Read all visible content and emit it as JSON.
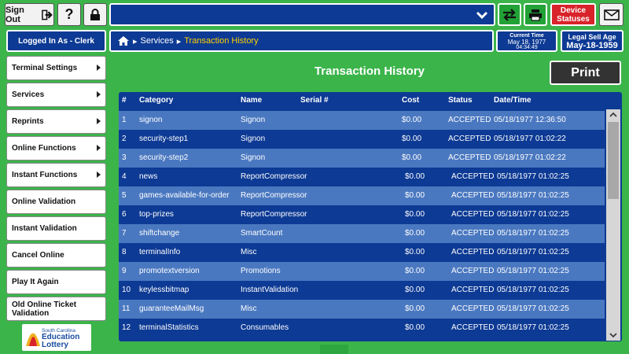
{
  "topbar": {
    "signout_label": "Sign Out",
    "help_label": "?",
    "device_line1": "Device",
    "device_line2": "Statuses"
  },
  "session": {
    "logged_in": "Logged In As - Clerk"
  },
  "breadcrumb": {
    "level1": "Services",
    "level2": "Transaction History"
  },
  "clock": {
    "label": "Current Time",
    "date": "May 18, 1977",
    "time": "04:34:49"
  },
  "sell_age": {
    "label": "Legal Sell Age",
    "date": "May-18-1959"
  },
  "sidebar": {
    "items": [
      {
        "label": "Terminal Settings",
        "arrow": true
      },
      {
        "label": "Services",
        "arrow": true
      },
      {
        "label": "Reprints",
        "arrow": true
      },
      {
        "label": "Online Functions",
        "arrow": true
      },
      {
        "label": "Instant Functions",
        "arrow": true
      },
      {
        "label": "Online Validation",
        "arrow": false
      },
      {
        "label": "Instant Validation",
        "arrow": false
      },
      {
        "label": "Cancel Online",
        "arrow": false
      },
      {
        "label": "Play It Again",
        "arrow": false
      },
      {
        "label": "Old Online Ticket Validation",
        "arrow": false
      }
    ]
  },
  "logo": {
    "line1": "South Carolina",
    "line2": "Education",
    "line3": "Lottery"
  },
  "main": {
    "title": "Transaction History",
    "print_label": "Print"
  },
  "table": {
    "headers": [
      "#",
      "Category",
      "Name",
      "Serial #",
      "Cost",
      "Status",
      "Date/Time"
    ],
    "rows": [
      [
        "1",
        "signon",
        "Signon",
        "",
        "$0.00",
        "ACCEPTED",
        "05/18/1977 12:36:50"
      ],
      [
        "2",
        "security-step1",
        "Signon",
        "",
        "$0.00",
        "ACCEPTED",
        "05/18/1977 01:02:22"
      ],
      [
        "3",
        "security-step2",
        "Signon",
        "",
        "$0.00",
        "ACCEPTED",
        "05/18/1977 01:02:22"
      ],
      [
        "4",
        "news",
        "ReportCompressor",
        "",
        "$0.00",
        "ACCEPTED",
        "05/18/1977 01:02:25"
      ],
      [
        "5",
        "games-available-for-order",
        "ReportCompressor",
        "",
        "$0.00",
        "ACCEPTED",
        "05/18/1977 01:02:25"
      ],
      [
        "6",
        "top-prizes",
        "ReportCompressor",
        "",
        "$0.00",
        "ACCEPTED",
        "05/18/1977 01:02:25"
      ],
      [
        "7",
        "shiftchange",
        "SmartCount",
        "",
        "$0.00",
        "ACCEPTED",
        "05/18/1977 01:02:25"
      ],
      [
        "8",
        "terminalInfo",
        "Misc",
        "",
        "$0.00",
        "ACCEPTED",
        "05/18/1977 01:02:25"
      ],
      [
        "9",
        "promotextversion",
        "Promotions",
        "",
        "$0.00",
        "ACCEPTED",
        "05/18/1977 01:02:25"
      ],
      [
        "10",
        "keylessbitmap",
        "InstantValidation",
        "",
        "$0.00",
        "ACCEPTED",
        "05/18/1977 01:02:25"
      ],
      [
        "11",
        "guaranteeMailMsg",
        "Misc",
        "",
        "$0.00",
        "ACCEPTED",
        "05/18/1977 01:02:25"
      ],
      [
        "12",
        "terminalStatistics",
        "Consumables",
        "",
        "$0.00",
        "ACCEPTED",
        "05/18/1977 01:02:25"
      ]
    ]
  },
  "colors": {
    "background": "#3bb44a",
    "navy": "#0d3a94",
    "row_alt": "#4a78c0",
    "breadcrumb_current": "#ffd200",
    "device_status": "#d8232a"
  }
}
